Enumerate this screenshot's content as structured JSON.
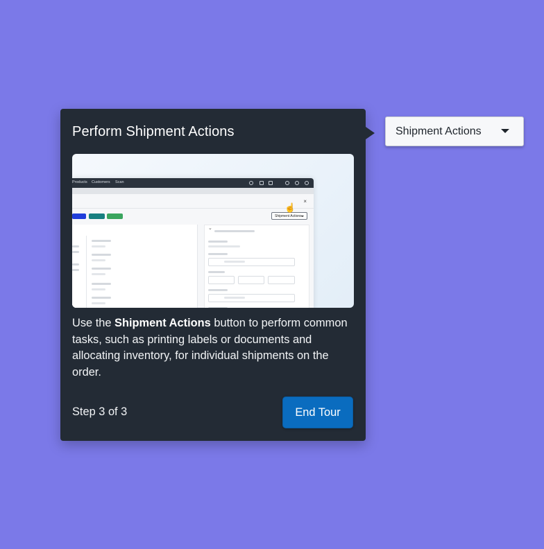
{
  "tour": {
    "title": "Perform Shipment Actions",
    "description_prefix": "Use the ",
    "description_bold": "Shipment Actions",
    "description_suffix": " button to perform common tasks, such as printing labels or documents and allocating inventory, for individual shipments on the order.",
    "step_text": "Step 3 of 3",
    "end_button_label": "End Tour"
  },
  "target_button": {
    "label": "Shipment Actions",
    "icon": "caret-down-icon"
  },
  "preview": {
    "nav_items": [
      "Products",
      "Customers",
      "Scan"
    ],
    "button_label": "Shipment Actions",
    "close_glyph": "×",
    "chevron_glyph": "⌄",
    "cursor_glyph": "☝",
    "pill_colors": [
      "#1f3ddb",
      "#177f80",
      "#3aa55e"
    ]
  },
  "colors": {
    "background": "#7b79e8",
    "card": "#232b35",
    "accent": "#0a6cbf"
  }
}
